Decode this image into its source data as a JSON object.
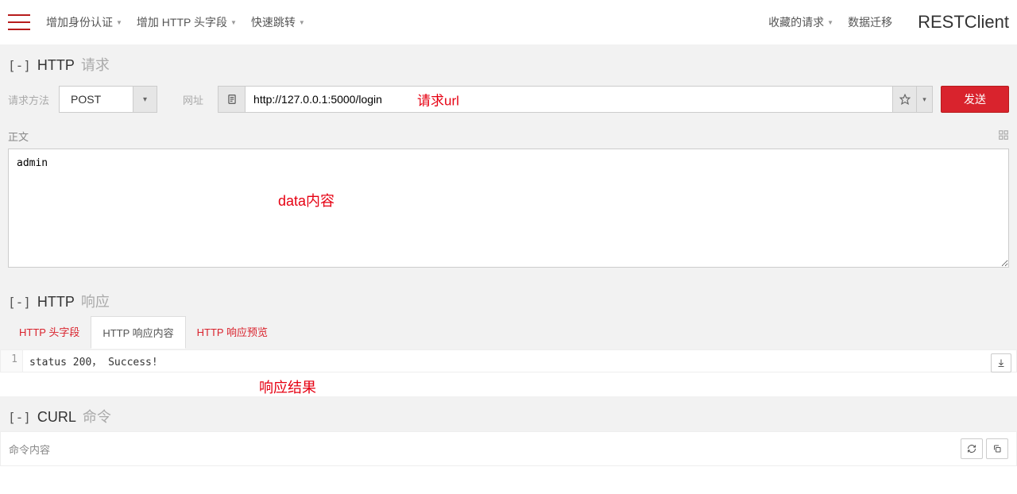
{
  "nav": {
    "auth": "增加身份认证",
    "headers": "增加 HTTP 头字段",
    "jump": "快速跳转",
    "fav": "收藏的请求",
    "migrate": "数据迁移"
  },
  "brand": "RESTClient",
  "request": {
    "toggle": "[-]",
    "title": "HTTP",
    "sub": "请求",
    "method_label": "请求方法",
    "method": "POST",
    "url_label": "网址",
    "url_value": "http://127.0.0.1:5000/login",
    "send": "发送",
    "body_label": "正文",
    "body_value": "admin"
  },
  "response": {
    "toggle": "[-]",
    "title": "HTTP",
    "sub": "响应",
    "tabs": {
      "headers": "HTTP 头字段",
      "content": "HTTP 响应内容",
      "preview": "HTTP 响应预览"
    },
    "line_no": "1",
    "body": "status 200， Success!"
  },
  "curl": {
    "toggle": "[-]",
    "title": "CURL",
    "sub": "命令",
    "label": "命令内容"
  },
  "annotations": {
    "url": "请求url",
    "data": "data内容",
    "resp": "响应结果"
  }
}
